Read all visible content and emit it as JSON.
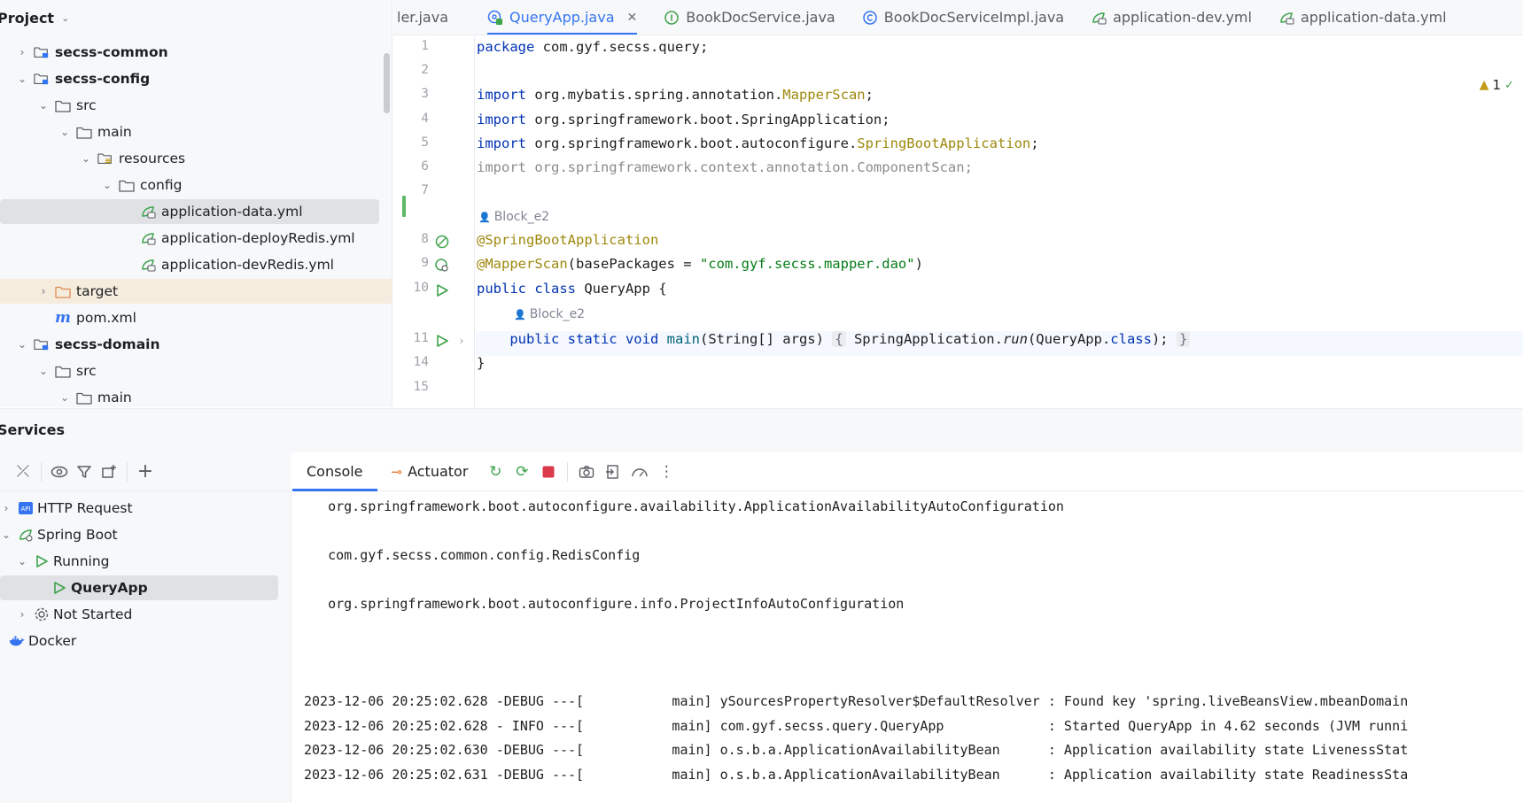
{
  "project": {
    "title": "Project",
    "items": [
      {
        "label": "secss-common",
        "bold": true,
        "arrow": "›",
        "icon": "module-folder-icon",
        "indent": 0
      },
      {
        "label": "secss-config",
        "bold": true,
        "arrow": "⌄",
        "icon": "module-folder-icon",
        "indent": 0
      },
      {
        "label": "src",
        "arrow": "⌄",
        "icon": "folder-icon",
        "indent": 1
      },
      {
        "label": "main",
        "arrow": "⌄",
        "icon": "folder-icon",
        "indent": 2
      },
      {
        "label": "resources",
        "arrow": "⌄",
        "icon": "resources-folder-icon",
        "indent": 3
      },
      {
        "label": "config",
        "arrow": "⌄",
        "icon": "folder-icon",
        "indent": 4
      },
      {
        "label": "application-data.yml",
        "arrow": "",
        "icon": "spring-yml-icon",
        "indent": 5,
        "selected": true
      },
      {
        "label": "application-deployRedis.yml",
        "arrow": "",
        "icon": "spring-yml-icon",
        "indent": 5
      },
      {
        "label": "application-devRedis.yml",
        "arrow": "",
        "icon": "spring-yml-icon",
        "indent": 5
      },
      {
        "label": "target",
        "arrow": "›",
        "icon": "excluded-folder-icon",
        "indent": 1,
        "excluded": true
      },
      {
        "label": "pom.xml",
        "arrow": "",
        "icon": "maven-icon",
        "indent": 1
      },
      {
        "label": "secss-domain",
        "bold": true,
        "arrow": "⌄",
        "icon": "module-folder-icon",
        "indent": 0
      },
      {
        "label": "src",
        "arrow": "⌄",
        "icon": "folder-icon",
        "indent": 1
      },
      {
        "label": "main",
        "arrow": "⌄",
        "icon": "folder-icon",
        "indent": 2
      }
    ]
  },
  "tabs": [
    {
      "label": "ler.java",
      "icon": "",
      "active": false
    },
    {
      "label": "QueryApp.java",
      "icon": "spring-class-icon",
      "active": true
    },
    {
      "label": "BookDocService.java",
      "icon": "interface-icon",
      "active": false
    },
    {
      "label": "BookDocServiceImpl.java",
      "icon": "class-icon",
      "active": false
    },
    {
      "label": "application-dev.yml",
      "icon": "spring-yml-icon",
      "active": false
    },
    {
      "label": "application-data.yml",
      "icon": "spring-yml-icon",
      "active": false
    }
  ],
  "editor": {
    "warnings_count": "1",
    "lines": [
      {
        "n": "1",
        "html": "<span class='kw'>package</span> com.gyf.secss.query;"
      },
      {
        "n": "2",
        "html": ""
      },
      {
        "n": "3",
        "html": "<span class='kw'>import</span> org.mybatis.spring.annotation.<span class='cls-y'>MapperScan</span>;"
      },
      {
        "n": "4",
        "html": "<span class='kw'>import</span> org.springframework.boot.SpringApplication;"
      },
      {
        "n": "5",
        "html": "<span class='kw'>import</span> org.springframework.boot.autoconfigure.<span class='cls-y'>SpringBootApplication</span>;"
      },
      {
        "n": "6",
        "html": "<span class='gray'>import org.springframework.context.annotation.ComponentScan;</span>"
      },
      {
        "n": "7",
        "html": ""
      },
      {
        "n": "8",
        "html": "<span class='ann'>@SpringBootApplication</span>"
      },
      {
        "n": "9",
        "html": "<span class='ann'>@MapperScan</span>(basePackages = <span class='str'>\"com.gyf.secss.mapper.dao\"</span>)"
      },
      {
        "n": "10",
        "html": "<span class='kw'>public class</span> QueryApp {"
      },
      {
        "n": "11",
        "html": "    <span class='kw'>public static void</span> <span class='mth'>main</span>(String[] args) <span class='fold-box'>{</span> SpringApplication.<span class='it'>run</span>(QueryApp.<span class='kw'>class</span>); <span class='fold-box'>}</span>"
      },
      {
        "n": "14",
        "html": "}"
      },
      {
        "n": "15",
        "html": ""
      }
    ],
    "author_hint": "Block_e2"
  },
  "services": {
    "title": "Services",
    "tree": [
      {
        "label": "HTTP Request",
        "arrow": "›",
        "icon": "http-request-icon",
        "indent": 0
      },
      {
        "label": "Spring Boot",
        "arrow": "⌄",
        "icon": "spring-boot-icon",
        "indent": 0
      },
      {
        "label": "Running",
        "arrow": "⌄",
        "icon": "run-icon",
        "indent": 1
      },
      {
        "label": "QueryApp",
        "arrow": "",
        "icon": "run-icon",
        "indent": 2,
        "selected": true
      },
      {
        "label": "Not Started",
        "arrow": "›",
        "icon": "gear-icon",
        "indent": 1
      },
      {
        "label": "Docker",
        "arrow": "",
        "icon": "docker-icon",
        "indent": 0
      }
    ],
    "console_tab": "Console",
    "actuator_tab": "Actuator"
  },
  "console": {
    "lines": [
      "   org.springframework.boot.autoconfigure.availability.ApplicationAvailabilityAutoConfiguration",
      "",
      "   com.gyf.secss.common.config.RedisConfig",
      "",
      "   org.springframework.boot.autoconfigure.info.ProjectInfoAutoConfiguration",
      "",
      "",
      "",
      "2023-12-06 20:25:02.628 -DEBUG ---[           main] ySourcesPropertyResolver$DefaultResolver : Found key 'spring.liveBeansView.mbeanDomain",
      "2023-12-06 20:25:02.628 - INFO ---[           main] com.gyf.secss.query.QueryApp             : Started QueryApp in 4.62 seconds (JVM runni",
      "2023-12-06 20:25:02.630 -DEBUG ---[           main] o.s.b.a.ApplicationAvailabilityBean      : Application availability state LivenessStat",
      "2023-12-06 20:25:02.631 -DEBUG ---[           main] o.s.b.a.ApplicationAvailabilityBean      : Application availability state ReadinessSta"
    ]
  },
  "colors": {
    "accent": "#3574f0",
    "keyword": "#0033b3",
    "annotation": "#9e880d",
    "string": "#067d17",
    "run_green": "#3fa34d",
    "stop_red": "#db3b4b"
  }
}
